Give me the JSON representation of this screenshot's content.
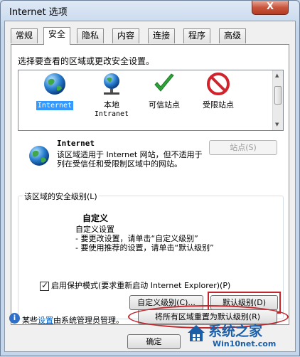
{
  "window": {
    "title": "Internet 选项",
    "close_label": "X"
  },
  "tabs": [
    {
      "label": "常规"
    },
    {
      "label": "安全"
    },
    {
      "label": "隐私"
    },
    {
      "label": "内容"
    },
    {
      "label": "连接"
    },
    {
      "label": "程序"
    },
    {
      "label": "高级"
    }
  ],
  "active_tab": "安全",
  "zones": {
    "prompt": "选择要查看的区域或更改安全设置。",
    "items": [
      {
        "name": "Internet",
        "sub": "",
        "icon": "globe-icon",
        "selected": true
      },
      {
        "name": "本地",
        "sub": "Intranet",
        "icon": "network-globe-icon",
        "selected": false
      },
      {
        "name": "可信站点",
        "sub": "",
        "icon": "checkmark-icon",
        "selected": false
      },
      {
        "name": "受限站点",
        "sub": "",
        "icon": "no-entry-icon",
        "selected": false
      }
    ]
  },
  "zone_info": {
    "title": "Internet",
    "description": "该区域适用于 Internet 网站，但不适用于列在受信任和受限制区域中的网站。",
    "sites_button": "站点(S)"
  },
  "security_level": {
    "legend": "该区域的安全级别(L)",
    "title": "自定义",
    "desc": "自定义设置\n- 要更改设置，请单击“自定义级别”\n- 要使用推荐的设置，请单击“默认级别”",
    "protected_mode_label": "启用保护模式(要求重新启动 Internet Explorer)(P)",
    "protected_mode_checked": true,
    "custom_level_button": "自定义级别(C)...",
    "default_level_button": "默认级别(D)"
  },
  "reset_all_button": "将所有区域重置为默认级别(R)",
  "footer": {
    "prefix": "某些",
    "link": "设置",
    "suffix": "由系统管理员管理。"
  },
  "buttons": {
    "ok": "确定"
  },
  "watermark": {
    "line1": "系统之家",
    "line2": "Win10net.com"
  },
  "colors": {
    "accent": "#3399ff",
    "annotation": "#c1272d",
    "link": "#0066cc"
  }
}
